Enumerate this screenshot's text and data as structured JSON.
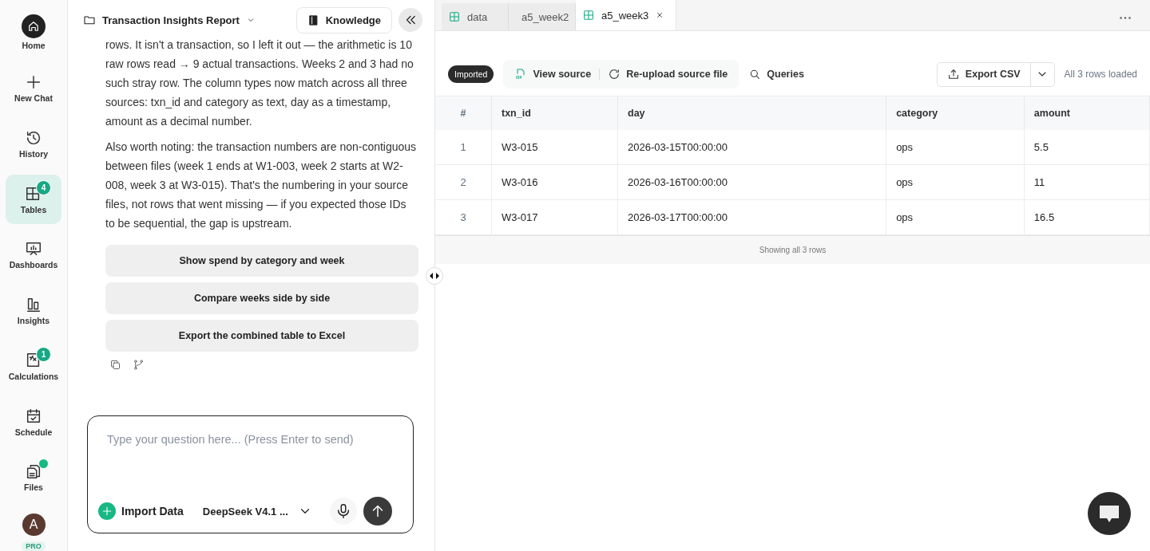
{
  "sidebar": {
    "items": [
      {
        "label": "Home",
        "selected": false
      },
      {
        "label": "New Chat",
        "selected": false
      },
      {
        "label": "History",
        "selected": false
      },
      {
        "label": "Tables",
        "selected": true,
        "badge": "4"
      },
      {
        "label": "Dashboards",
        "selected": false
      },
      {
        "label": "Insights",
        "selected": false
      },
      {
        "label": "Calculations",
        "selected": false,
        "badge": "1"
      },
      {
        "label": "Schedule",
        "selected": false
      },
      {
        "label": "Files",
        "selected": false,
        "dot": true
      }
    ],
    "user": {
      "initial": "A",
      "plan": "PRO"
    }
  },
  "chat": {
    "project": "Transaction Insights Report",
    "knowledge_button": "Knowledge",
    "paragraphs": [
      "rows. It isn't a transaction, so I left it out — the arithmetic is 10 raw rows read → 9 actual transactions. Weeks 2 and 3 had no such stray row. The column types now match across all three sources: txn_id and category as text, day as a timestamp, amount as a decimal number.",
      "Also worth noting: the transaction numbers are non-contiguous between files (week 1 ends at W1-003, week 2 starts at W2-008, week 3 at W3-015). That's the numbering in your source files, not rows that went missing — if you expected those IDs to be sequential, the gap is upstream."
    ],
    "suggestions": [
      "Show spend by category and week",
      "Compare weeks side by side",
      "Export the combined table to Excel"
    ],
    "input": {
      "placeholder": "Type your question here... (Press Enter to send)"
    },
    "import_button": "Import Data",
    "model": "DeepSeek V4.1 ..."
  },
  "tabs": [
    {
      "label": "data",
      "selected": false
    },
    {
      "label": "a5_week2",
      "selected": false
    },
    {
      "label": "a5_week3",
      "selected": true
    }
  ],
  "toolbar": {
    "status": "Imported",
    "view_source": "View source",
    "reupload": "Re-upload source file",
    "queries": "Queries",
    "export": "Export CSV",
    "loaded": "All 3 rows loaded"
  },
  "table": {
    "columns": [
      "#",
      "txn_id",
      "day",
      "category",
      "amount"
    ],
    "rows": [
      [
        "1",
        "W3-015",
        "2026-03-15T00:00:00",
        "ops",
        "5.5"
      ],
      [
        "2",
        "W3-016",
        "2026-03-16T00:00:00",
        "ops",
        "11"
      ],
      [
        "3",
        "W3-017",
        "2026-03-17T00:00:00",
        "ops",
        "16.5"
      ]
    ],
    "footer": "Showing all 3 rows"
  }
}
